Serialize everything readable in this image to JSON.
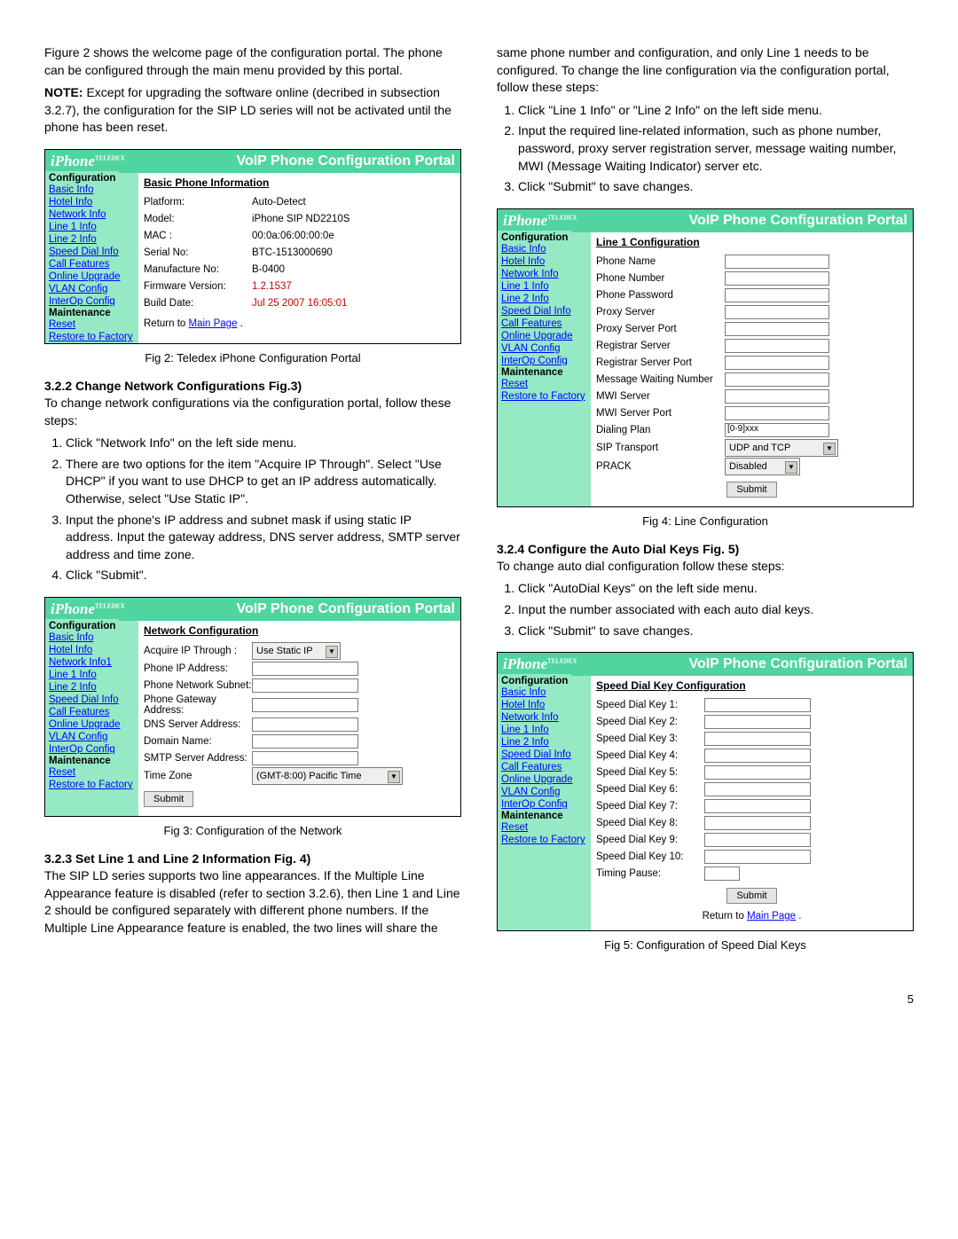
{
  "pageNumber": "5",
  "left": {
    "intro": "Figure 2 shows the welcome page of the configuration portal. The phone can be configured through the main menu provided by this portal.",
    "noteLabel": "NOTE:",
    "noteText": " Except for upgrading the software online (decribed in subsection 3.2.7), the configuration for the SIP LD series will not be activated until the phone has been reset.",
    "fig2": {
      "portalTitle": "VoIP Phone Configuration Portal",
      "logo": "iPhone",
      "configLabel": "Configuration",
      "maintLabel": "Maintenance",
      "menu": [
        "Basic Info",
        "Hotel Info",
        "Network Info",
        "Line 1 Info",
        "Line 2 Info",
        "Speed Dial Info",
        "Call Features",
        "Online Upgrade",
        "VLAN Config",
        "InterOp Config"
      ],
      "maint": [
        "Reset",
        "Restore to Factory"
      ],
      "heading": "Basic Phone Information",
      "rows": [
        {
          "l": "Platform:",
          "v": "Auto-Detect"
        },
        {
          "l": "Model:",
          "v": "iPhone SIP ND2210S"
        },
        {
          "l": "MAC :",
          "v": "00:0a:06:00:00:0e"
        },
        {
          "l": "Serial No:",
          "v": "BTC-1513000690"
        },
        {
          "l": "Manufacture No:",
          "v": "B-0400"
        },
        {
          "l": "Firmware Version:",
          "v": "1.2.1537",
          "red": true
        },
        {
          "l": "Build Date:",
          "v": "Jul 25 2007 16:05:01",
          "red": true
        }
      ],
      "return": "Return to ",
      "returnLink": "Main Page",
      "caption": "Fig 2: Teledex iPhone Configuration Portal"
    },
    "sec322": {
      "title": "3.2.2  Change Network Configurations Fig.3)",
      "text": "To change network configurations via the configuration portal, follow these steps:",
      "steps": [
        "Click \"Network Info\" on the left side menu.",
        "There are two options for the item \"Acquire IP Through\". Select \"Use DHCP\" if you want to use DHCP to get an IP address automatically. Otherwise, select \"Use Static IP\".",
        "Input the phone's IP address and subnet mask if using static IP address. Input the gateway address, DNS server address, SMTP server address and time zone.",
        "Click \"Submit\"."
      ]
    },
    "fig3": {
      "heading": "Network Configuration",
      "menuHighlight": "Network Info1",
      "rows": [
        {
          "l": "Acquire IP Through :",
          "sel": "Use Static IP"
        },
        {
          "l": "Phone IP Address:",
          "inp": true
        },
        {
          "l": "Phone Network Subnet:",
          "inp": true
        },
        {
          "l": "Phone Gateway Address:",
          "inp": true
        },
        {
          "l": "DNS Server Address:",
          "inp": true
        },
        {
          "l": "Domain Name:",
          "inp": true
        },
        {
          "l": "SMTP Server Address:",
          "inp": true
        },
        {
          "l": "Time Zone",
          "sel": "(GMT-8:00) Pacific Time"
        }
      ],
      "submit": "Submit",
      "caption": "Fig 3: Configuration of the Network"
    },
    "sec323": {
      "title": "3.2.3 Set Line 1 and Line 2 Information Fig. 4)",
      "text": "The SIP LD series supports two line appearances. If the Multiple Line Appearance feature is disabled (refer to section 3.2.6), then Line 1 and Line 2 should be configured separately with different phone numbers. If the Multiple Line Appearance feature is enabled, the two lines will share the"
    }
  },
  "right": {
    "cont": "same phone number and configuration, and only Line 1 needs to be configured. To change the line configuration via the configuration portal, follow these steps:",
    "steps323": [
      "Click \"Line 1 Info\" or \"Line 2 Info\" on the left side menu.",
      "Input the required line-related information, such as phone number, password, proxy server registration server, message waiting number, MWI (Message Waiting Indicator) server etc.",
      "Click \"Submit\" to save changes."
    ],
    "fig4": {
      "heading": "Line 1  Configuration",
      "rows": [
        {
          "l": "Phone Name",
          "inp": true
        },
        {
          "l": "Phone Number",
          "inp": true
        },
        {
          "l": "Phone Password",
          "inp": true
        },
        {
          "l": "Proxy Server",
          "inp": true
        },
        {
          "l": "Proxy Server Port",
          "inp": true
        },
        {
          "l": "Registrar Server",
          "inp": true
        },
        {
          "l": "Registrar Server Port",
          "inp": true
        },
        {
          "l": "Message Waiting Number",
          "inp": true
        },
        {
          "l": "MWI Server",
          "inp": true
        },
        {
          "l": "MWI Server Port",
          "inp": true
        },
        {
          "l": "Dialing Plan",
          "txt": "[0-9]xxx"
        },
        {
          "l": "SIP Transport",
          "sel": "UDP and TCP",
          "wide": true
        },
        {
          "l": "PRACK",
          "sel": "Disabled"
        }
      ],
      "submit": "Submit",
      "caption": "Fig 4: Line Configuration"
    },
    "sec324": {
      "title": "3.2.4 Configure the Auto Dial Keys Fig. 5)",
      "text": "To change auto dial configuration follow these steps:",
      "steps": [
        "Click \"AutoDial Keys\" on the left side menu.",
        "Input the number associated with each auto dial keys.",
        "Click \"Submit\" to save changes."
      ]
    },
    "fig5": {
      "heading": "Speed Dial Key Configuration",
      "rows": [
        {
          "l": "Speed Dial Key 1:"
        },
        {
          "l": "Speed Dial Key 2:"
        },
        {
          "l": "Speed Dial Key 3:"
        },
        {
          "l": "Speed Dial Key 4:"
        },
        {
          "l": "Speed Dial Key 5:"
        },
        {
          "l": "Speed Dial Key 6:"
        },
        {
          "l": "Speed Dial Key 7:"
        },
        {
          "l": "Speed Dial Key 8:"
        },
        {
          "l": "Speed Dial Key 9:"
        },
        {
          "l": "Speed Dial Key 10:"
        },
        {
          "l": "Timing Pause:",
          "narrow": true
        }
      ],
      "submit": "Submit",
      "return": "Return to ",
      "returnLink": "Main Page",
      "caption": "Fig 5: Configuration of Speed Dial Keys"
    }
  }
}
